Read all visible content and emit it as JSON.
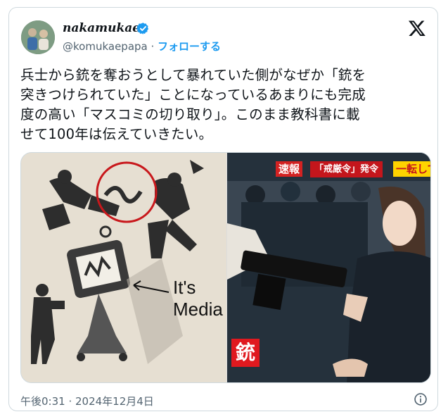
{
  "author": {
    "display_name": "nakamukae",
    "handle": "@komukaepapa",
    "separator": " · ",
    "follow_label": "フォローする",
    "verified_color": "#1d9bf0"
  },
  "tweet": {
    "text_lines": [
      "兵士から銃を奪おうとして暴れていた側がなぜか「銃を",
      "突きつけられていた」ことになっているあまりにも完成",
      "度の高い「マスコミの切り取り」。このまま教科書に載",
      "せて100年は伝えていきたい。"
    ]
  },
  "media": {
    "left_caption_line1": "It's",
    "left_caption_line2": "Media",
    "right_tag_breaking": "速報",
    "right_tag_headline": "「戒厳令」発令",
    "right_tag_sub": "一転して",
    "right_tag_gun": "銃",
    "accent_red": "#d32222"
  },
  "footer": {
    "timestamp": "午後0:31 · 2024年12月4日"
  },
  "icons": [
    "verified-badge-icon",
    "x-logo-icon",
    "info-icon",
    "avatar"
  ]
}
